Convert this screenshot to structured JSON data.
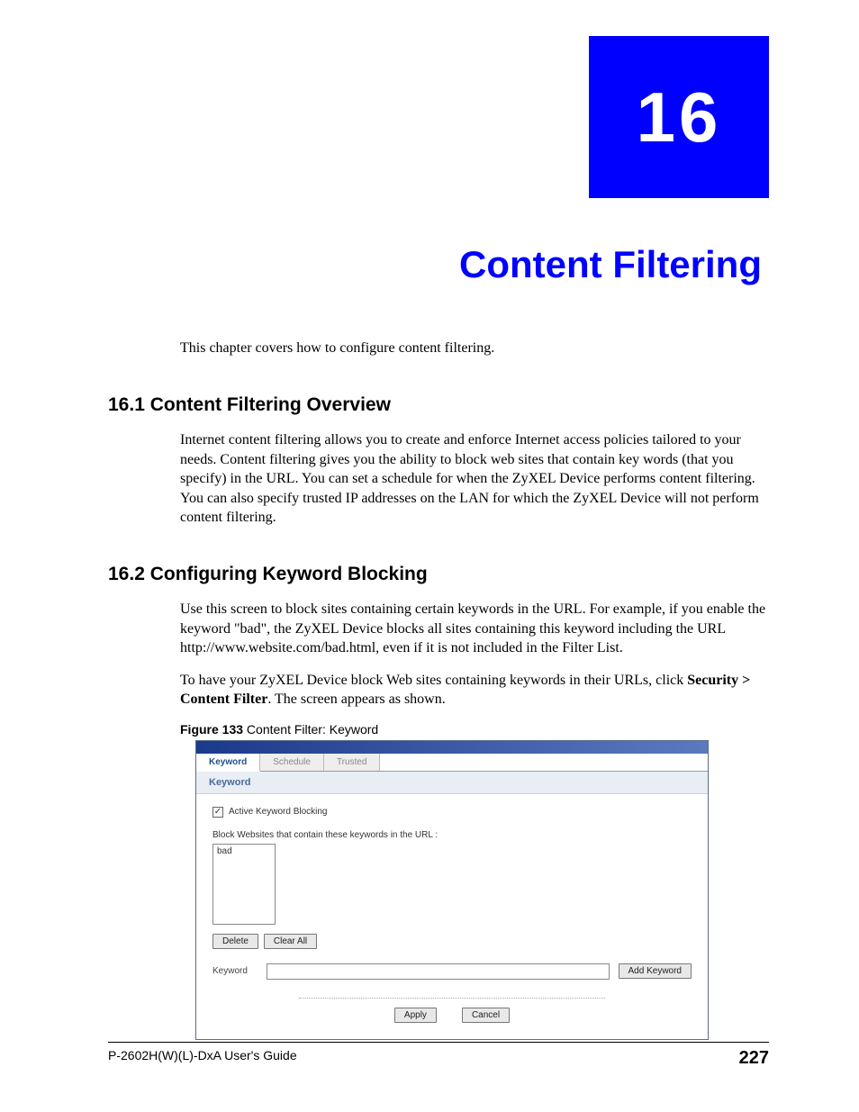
{
  "chapter": {
    "number": "16",
    "title": "Content Filtering"
  },
  "intro": "This chapter covers how to configure content filtering.",
  "section1": {
    "heading": "16.1  Content Filtering Overview",
    "p1": "Internet content filtering allows you to create and enforce Internet access policies tailored to your needs. Content filtering gives you the ability to block web sites that contain key words (that you specify) in the URL. You can set a schedule for when the ZyXEL Device performs content filtering. You can also specify trusted IP addresses on the LAN for which the ZyXEL Device will not perform content filtering."
  },
  "section2": {
    "heading": "16.2  Configuring Keyword Blocking",
    "p1": "Use this screen to block sites containing certain keywords in the URL. For example, if you enable the keyword \"bad\", the ZyXEL Device blocks all sites containing this keyword including the URL http://www.website.com/bad.html, even if it is not included in the Filter List.",
    "p2a": "To have your ZyXEL Device block Web sites containing keywords in their URLs, click ",
    "p2b": "Security > Content Filter",
    "p2c": ". The screen appears as shown."
  },
  "figure": {
    "label": "Figure 133",
    "caption": "   Content Filter: Keyword"
  },
  "ui": {
    "tabs": {
      "keyword": "Keyword",
      "schedule": "Schedule",
      "trusted": "Trusted"
    },
    "panel_header": "Keyword",
    "checkbox_mark": "✓",
    "checkbox_label": "Active Keyword Blocking",
    "block_label": "Block Websites that contain these keywords in the URL :",
    "listbox_item": "bad",
    "buttons": {
      "delete": "Delete",
      "clear_all": "Clear All",
      "add_keyword": "Add Keyword",
      "apply": "Apply",
      "cancel": "Cancel"
    },
    "keyword_label": "Keyword",
    "keyword_input_value": ""
  },
  "footer": {
    "guide": "P-2602H(W)(L)-DxA User's Guide",
    "page": "227"
  }
}
